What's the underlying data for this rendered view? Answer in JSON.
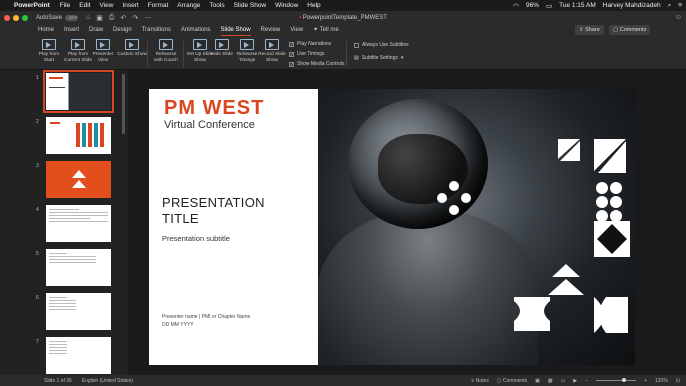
{
  "menubar": {
    "app": "PowerPoint",
    "menus": [
      "File",
      "Edit",
      "View",
      "Insert",
      "Format",
      "Arrange",
      "Tools",
      "Slide Show",
      "Window",
      "Help"
    ],
    "battery": "96%",
    "time": "Tue 1:15 AM",
    "user": "Harvey Mahdizadeh"
  },
  "titlebar": {
    "autosave": "AutoSave",
    "autosave_state": "OFF",
    "doc_title": "PowerpointTemplate_PMWEST"
  },
  "tabs": [
    "Home",
    "Insert",
    "Draw",
    "Design",
    "Transitions",
    "Animations",
    "Slide Show",
    "Review",
    "View",
    "Tell me"
  ],
  "active_tab": "Slide Show",
  "share": "Share",
  "comments": "Comments",
  "ribbon": {
    "play_from_start": "Play from Start",
    "play_from_current": "Play from Current Slide",
    "presenter_view": "Presenter View",
    "custom_show": "Custom Show",
    "rehearse_coach": "Rehearse with Coach",
    "set_up": "Set Up Slide Show",
    "hide_slide": "Hide Slide",
    "rehearse_timings": "Rehearse Timings",
    "record": "Record Slide Show",
    "play_narrations": "Play Narrations",
    "use_timings": "Use Timings",
    "show_media_controls": "Show Media Controls",
    "always_use_subtitles": "Always Use Subtitles",
    "subtitle_settings": "Subtitle Settings"
  },
  "thumbnails": [
    "1",
    "2",
    "3",
    "4",
    "5",
    "6",
    "7"
  ],
  "slide": {
    "logo": "PM WEST",
    "logo_sub": "Virtual Conference",
    "title_line1": "PRESENTATION",
    "title_line2": "TITLE",
    "subtitle": "Presentation subtitle",
    "presenter": "Presenter name  |  PMI or Chapter Name",
    "date": "DD MM YYYY"
  },
  "status": {
    "slide_count": "Slide 1 of 36",
    "language": "English (United States)",
    "notes": "Notes",
    "comments": "Comments",
    "zoom": "120%"
  },
  "colors": {
    "accent": "#d24726",
    "brand_orange": "#d9461f"
  }
}
